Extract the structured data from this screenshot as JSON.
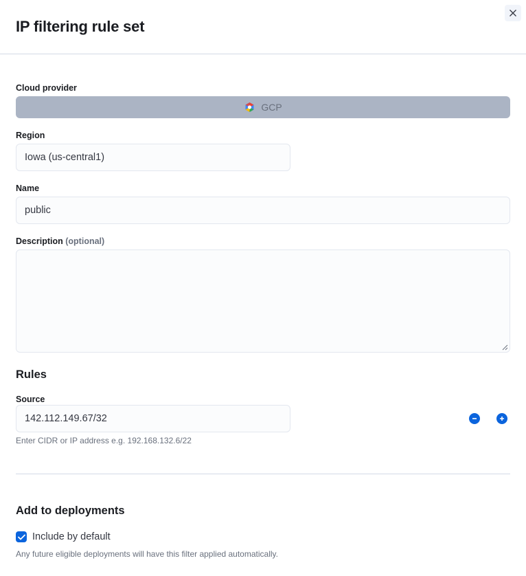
{
  "flyout": {
    "title": "IP filtering rule set"
  },
  "cloud_provider": {
    "label": "Cloud provider",
    "value": "GCP",
    "icon": "gcp-logo-icon"
  },
  "region": {
    "label": "Region",
    "value": "Iowa (us-central1)"
  },
  "name": {
    "label": "Name",
    "value": "public"
  },
  "description": {
    "label": "Description",
    "optional_label": "(optional)",
    "value": ""
  },
  "rules": {
    "title": "Rules",
    "source_label": "Source",
    "source_value": "142.112.149.67/32",
    "help_text": "Enter CIDR or IP address e.g. 192.168.132.6/22",
    "remove_icon": "minus-circle-icon",
    "add_icon": "plus-circle-icon"
  },
  "deployments": {
    "title": "Add to deployments",
    "checkbox_label": "Include by default",
    "checked": true,
    "help_text": "Any future eligible deployments will have this filter applied automatically."
  },
  "colors": {
    "primary": "#0b64dd",
    "disabled_bg": "#abb4c4",
    "border": "#d3dae6"
  }
}
